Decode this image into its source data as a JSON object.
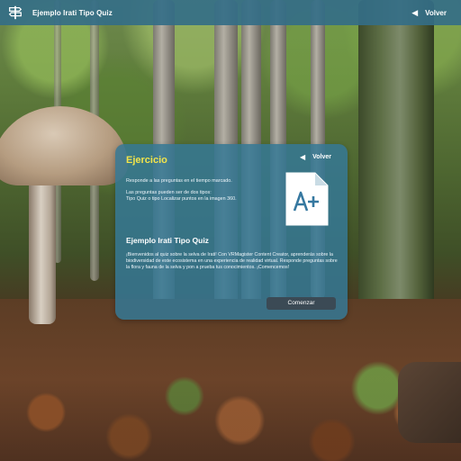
{
  "app": {
    "title": "Ejemplo Irati Tipo Quiz",
    "back_label": "Volver"
  },
  "panel": {
    "title": "Ejercicio",
    "back_label": "Volver",
    "instructions": [
      "Responde a las  preguntas en el tiempo marcado.",
      "Las preguntas pueden ser de dos tipos:",
      "Tipo Quiz o tipo Localizar puntos en la imagen 360."
    ],
    "icon": "document-a-plus-icon",
    "quiz_title": "Ejemplo Irati Tipo Quiz",
    "quiz_description": "¡Bienvenidos al quiz sobre la selva de Irati! Con VRMagister Content Creator, aprenderás sobre la biodiversidad de este ecosistema en una experiencia de realidad virtual. Responde preguntas sobre la flora y fauna de la selva y pon a prueba tus conocimientos. ¡Comencemos!",
    "start_label": "Comenzar"
  },
  "colors": {
    "topbar": "#346e87",
    "panel": "#3678a0",
    "title_accent": "#f3e44a",
    "button": "#3b4a55"
  }
}
